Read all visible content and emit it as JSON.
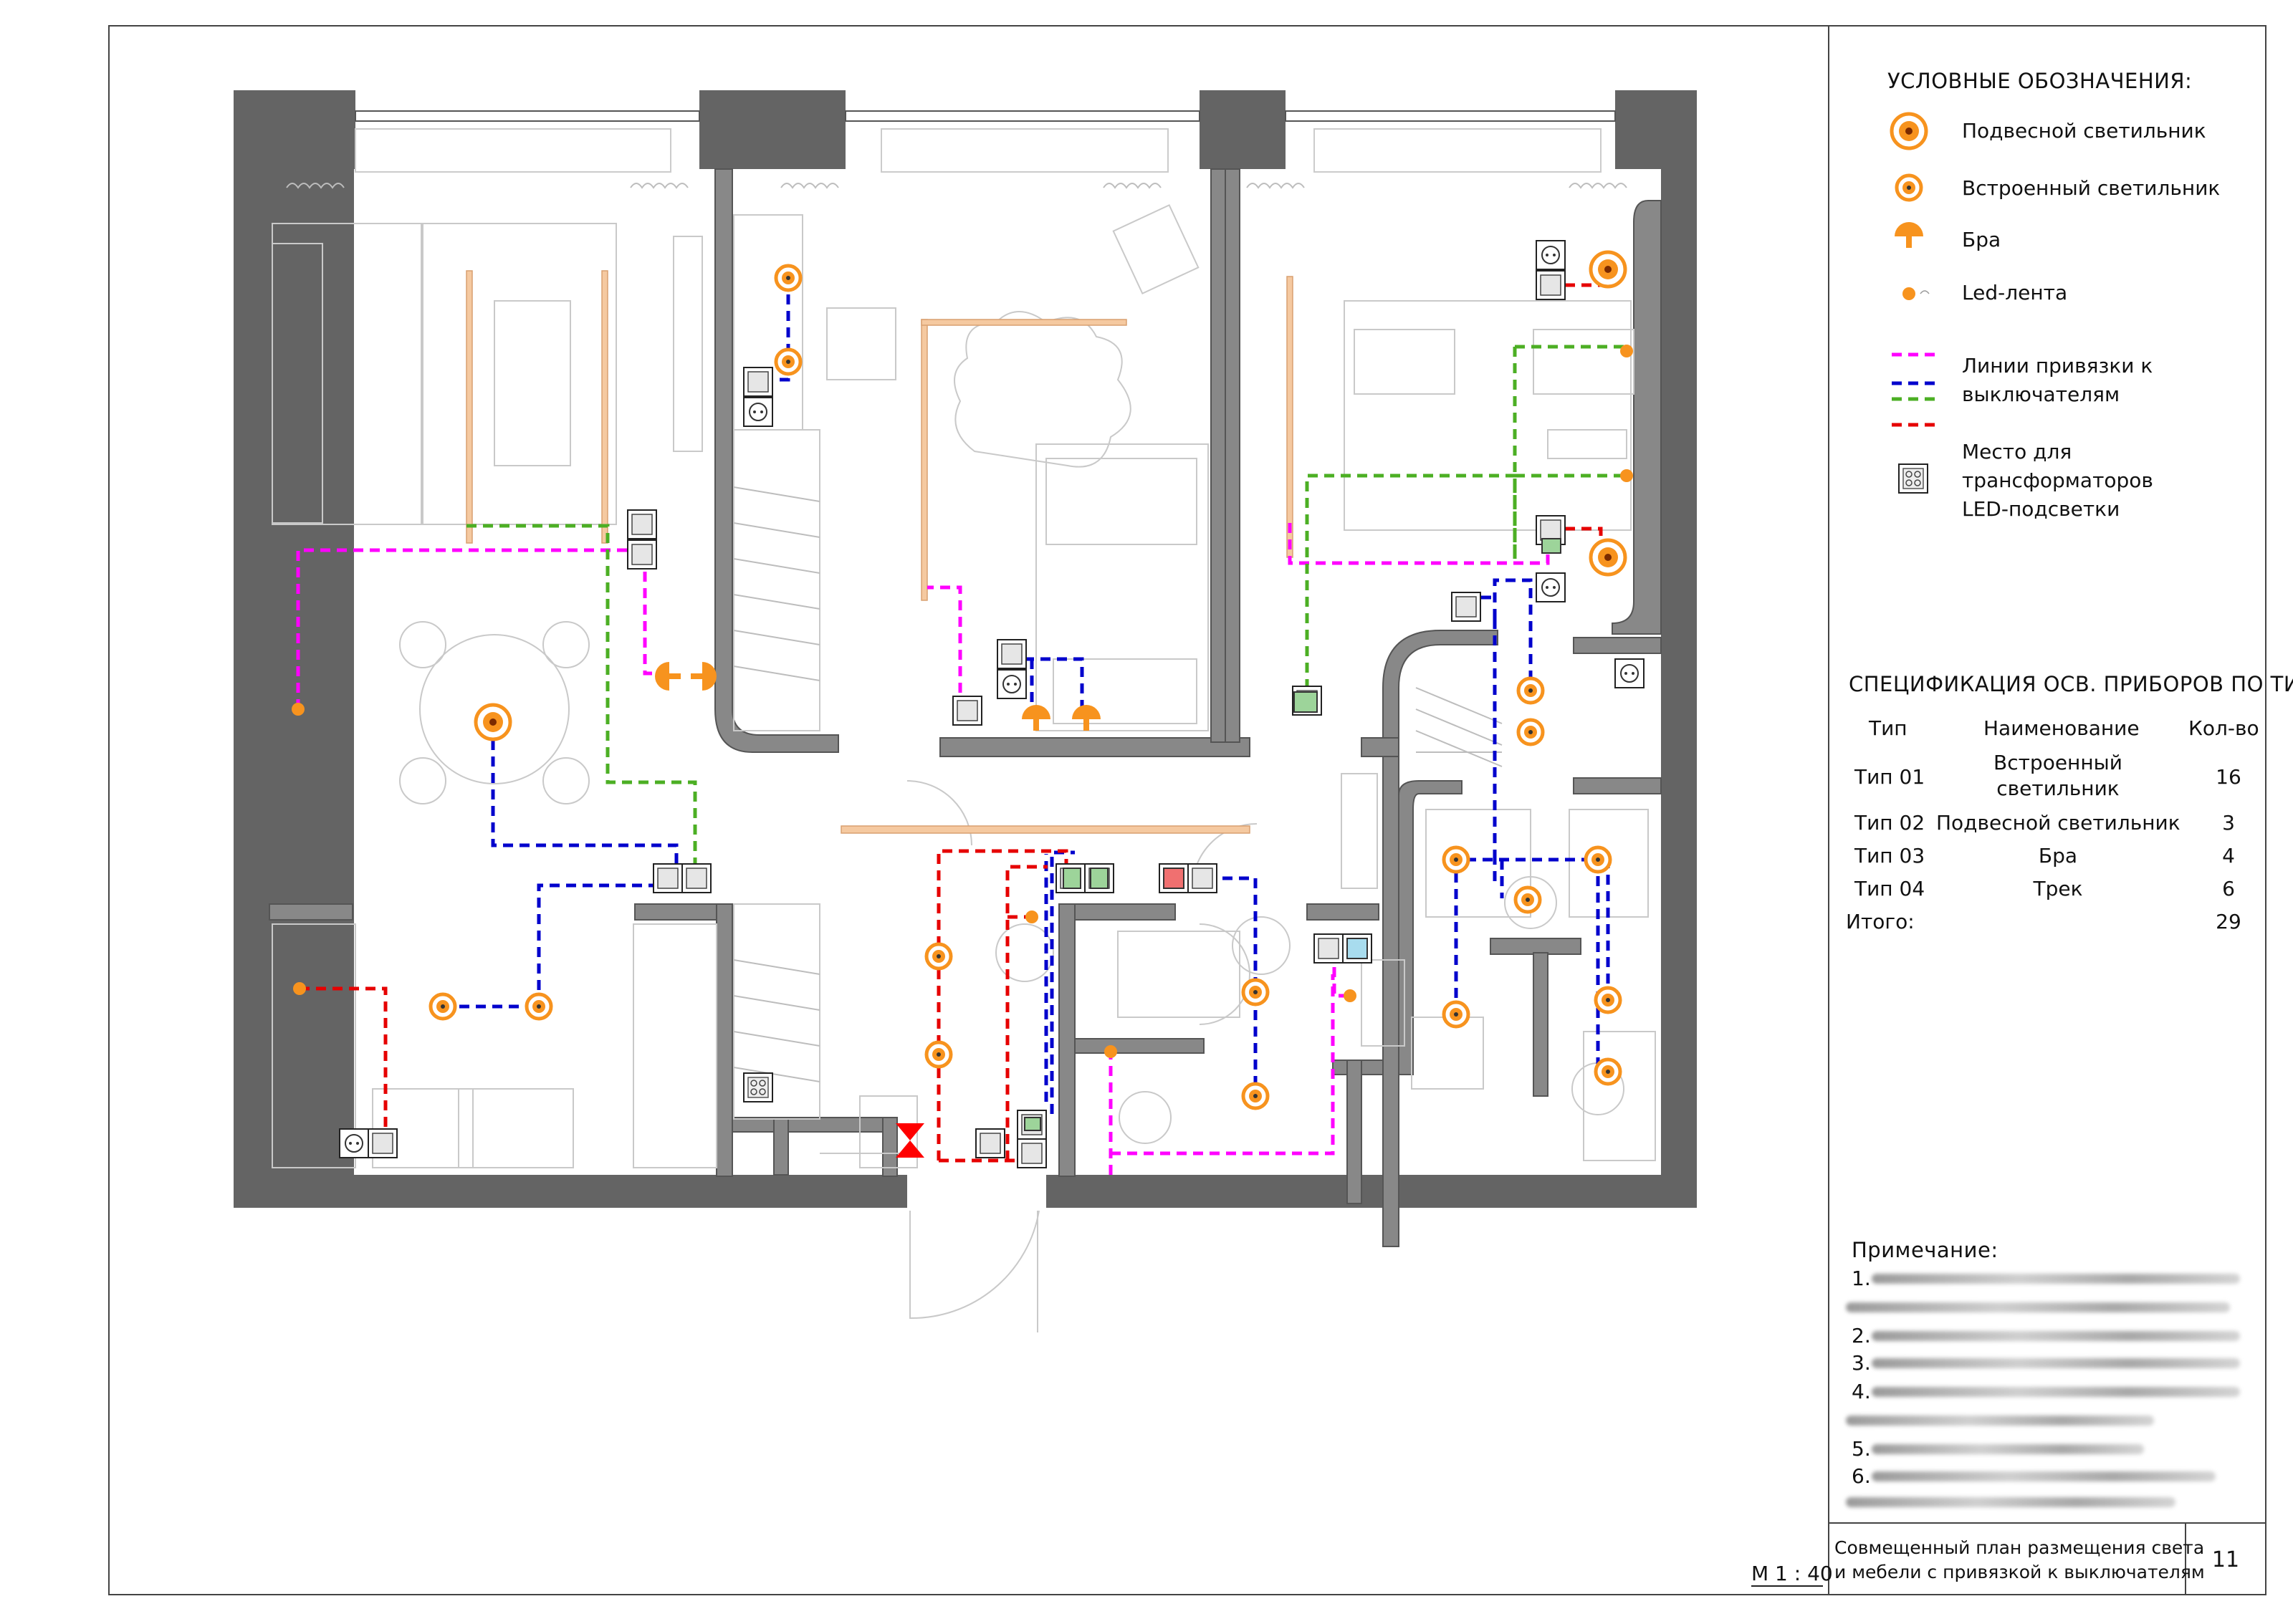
{
  "legend": {
    "title": "УСЛОВНЫЕ ОБОЗНАЧЕНИЯ:",
    "items": [
      {
        "icon": "pendant-light-icon",
        "label": "Подвесной светильник"
      },
      {
        "icon": "recessed-light-icon",
        "label": "Встроенный светильник"
      },
      {
        "icon": "wall-sconce-icon",
        "label": "Бра"
      },
      {
        "icon": "led-strip-icon",
        "label": "Led-лента"
      }
    ],
    "lines_label_1": "Линии привязки к",
    "lines_label_2": "выключателям",
    "transformer_label_1": "Место для",
    "transformer_label_2": "трансформаторов",
    "transformer_label_3": "LED-подсветки"
  },
  "spec": {
    "title": "СПЕЦИФИКАЦИЯ ОСВ. ПРИБОРОВ ПО ТИПУ",
    "headers": {
      "type": "Тип",
      "name": "Наименование",
      "qty": "Кол-во"
    },
    "rows": [
      {
        "type": "Тип 01",
        "name_1": "Встроенный",
        "name_2": "светильник",
        "qty": "16"
      },
      {
        "type": "Тип 02",
        "name_1": "Подвесной светильник",
        "name_2": "",
        "qty": "3"
      },
      {
        "type": "Тип 03",
        "name_1": "Бра",
        "name_2": "",
        "qty": "4"
      },
      {
        "type": "Тип 04",
        "name_1": "Трек",
        "name_2": "",
        "qty": "6"
      }
    ],
    "total_label": "Итого:",
    "total_qty": "29"
  },
  "notes": {
    "title": "Примечание:",
    "numbers": [
      "1.",
      "2.",
      "3.",
      "4.",
      "5.",
      "6."
    ]
  },
  "title_block": {
    "line_1": "Совмещенный план размещения света",
    "line_2": "и мебели с привязкой к выключателям",
    "sheet_number": "11"
  },
  "scale": "М 1 : 40",
  "colors": {
    "wall": "#646464",
    "light": "#f7931e",
    "link_magenta": "#ff00ff",
    "link_blue": "#0000cc",
    "link_green": "#4caf24",
    "link_red": "#e60000",
    "track": "#f5c9a0"
  }
}
